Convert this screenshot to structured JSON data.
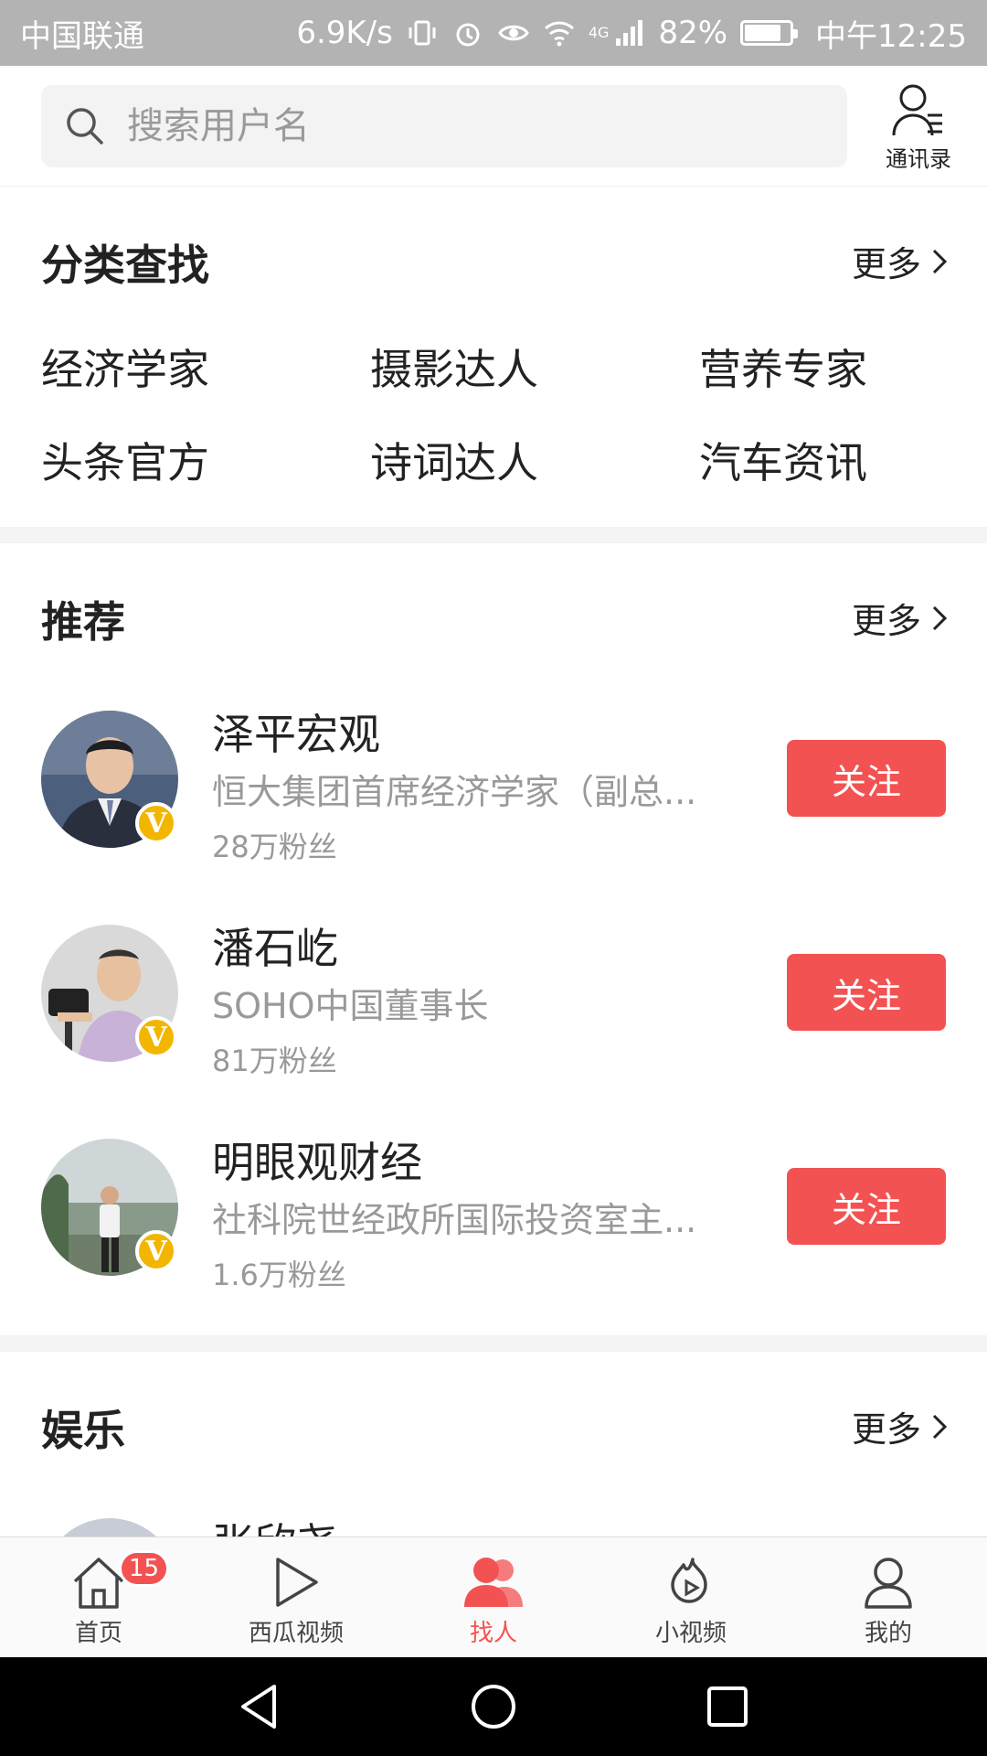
{
  "status_bar": {
    "carrier": "中国联通",
    "speed": "6.9K/s",
    "battery": "82%",
    "battery_level": 0.82,
    "time": "中午12:25",
    "network": "4G"
  },
  "search": {
    "placeholder": "搜索用户名",
    "contacts_label": "通讯录"
  },
  "categories": {
    "title": "分类查找",
    "more": "更多",
    "items": [
      "经济学家",
      "摄影达人",
      "营养专家",
      "头条官方",
      "诗词达人",
      "汽车资讯"
    ]
  },
  "recommend": {
    "title": "推荐",
    "more": "更多",
    "users": [
      {
        "name": "泽平宏观",
        "desc": "恒大集团首席经济学家（副总...",
        "fans": "28万粉丝",
        "follow": "关注"
      },
      {
        "name": "潘石屹",
        "desc": "SOHO中国董事长",
        "fans": "81万粉丝",
        "follow": "关注"
      },
      {
        "name": "明眼观财经",
        "desc": "社科院世经政所国际投资室主...",
        "fans": "1.6万粉丝",
        "follow": "关注"
      }
    ]
  },
  "entertainment": {
    "title": "娱乐",
    "more": "更多",
    "partial_name": "张欣尧"
  },
  "verified_badge": "V",
  "bottom_nav": {
    "items": [
      {
        "label": "首页",
        "badge": "15"
      },
      {
        "label": "西瓜视频"
      },
      {
        "label": "找人",
        "active": true
      },
      {
        "label": "小视频"
      },
      {
        "label": "我的"
      }
    ]
  },
  "colors": {
    "accent": "#f35252",
    "status_bar": "#b3b3b3",
    "verified": "#f2b600"
  }
}
